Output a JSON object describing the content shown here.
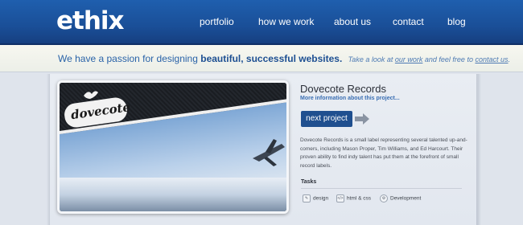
{
  "header": {
    "logo": "ethix",
    "nav": [
      "portfolio",
      "how we work",
      "about us",
      "contact",
      "blog"
    ]
  },
  "tagline": {
    "lead": "We have a passion for designing",
    "emphasis": "beautiful, successful websites.",
    "aside_prefix": "Take a look at",
    "aside_link1": "our work",
    "aside_middle": "and feel free to",
    "aside_link2": "contact us",
    "aside_suffix": "."
  },
  "project": {
    "screenshot_badge": "dovecote",
    "title": "Dovecote Records",
    "more_link": "More information about this project...",
    "next_button": "next project",
    "description": "Dovecote Records is a small label representing several talented up-and-comers, including Mason Proper, Tim Williams, and Ed Harcourt. Their proven ability to find indy talent has put them at the forefront of small record labels.",
    "tasks_heading": "Tasks",
    "tasks": [
      {
        "label": "design",
        "icon": "design-icon",
        "glyph": "✎"
      },
      {
        "label": "html & css",
        "icon": "code-icon",
        "glyph": "</>"
      },
      {
        "label": "Development",
        "icon": "gear-icon",
        "glyph": "⚙"
      }
    ]
  },
  "colors": {
    "header": "#1a4f98",
    "accent": "#1f4f8f",
    "link": "#3b6fb3"
  }
}
